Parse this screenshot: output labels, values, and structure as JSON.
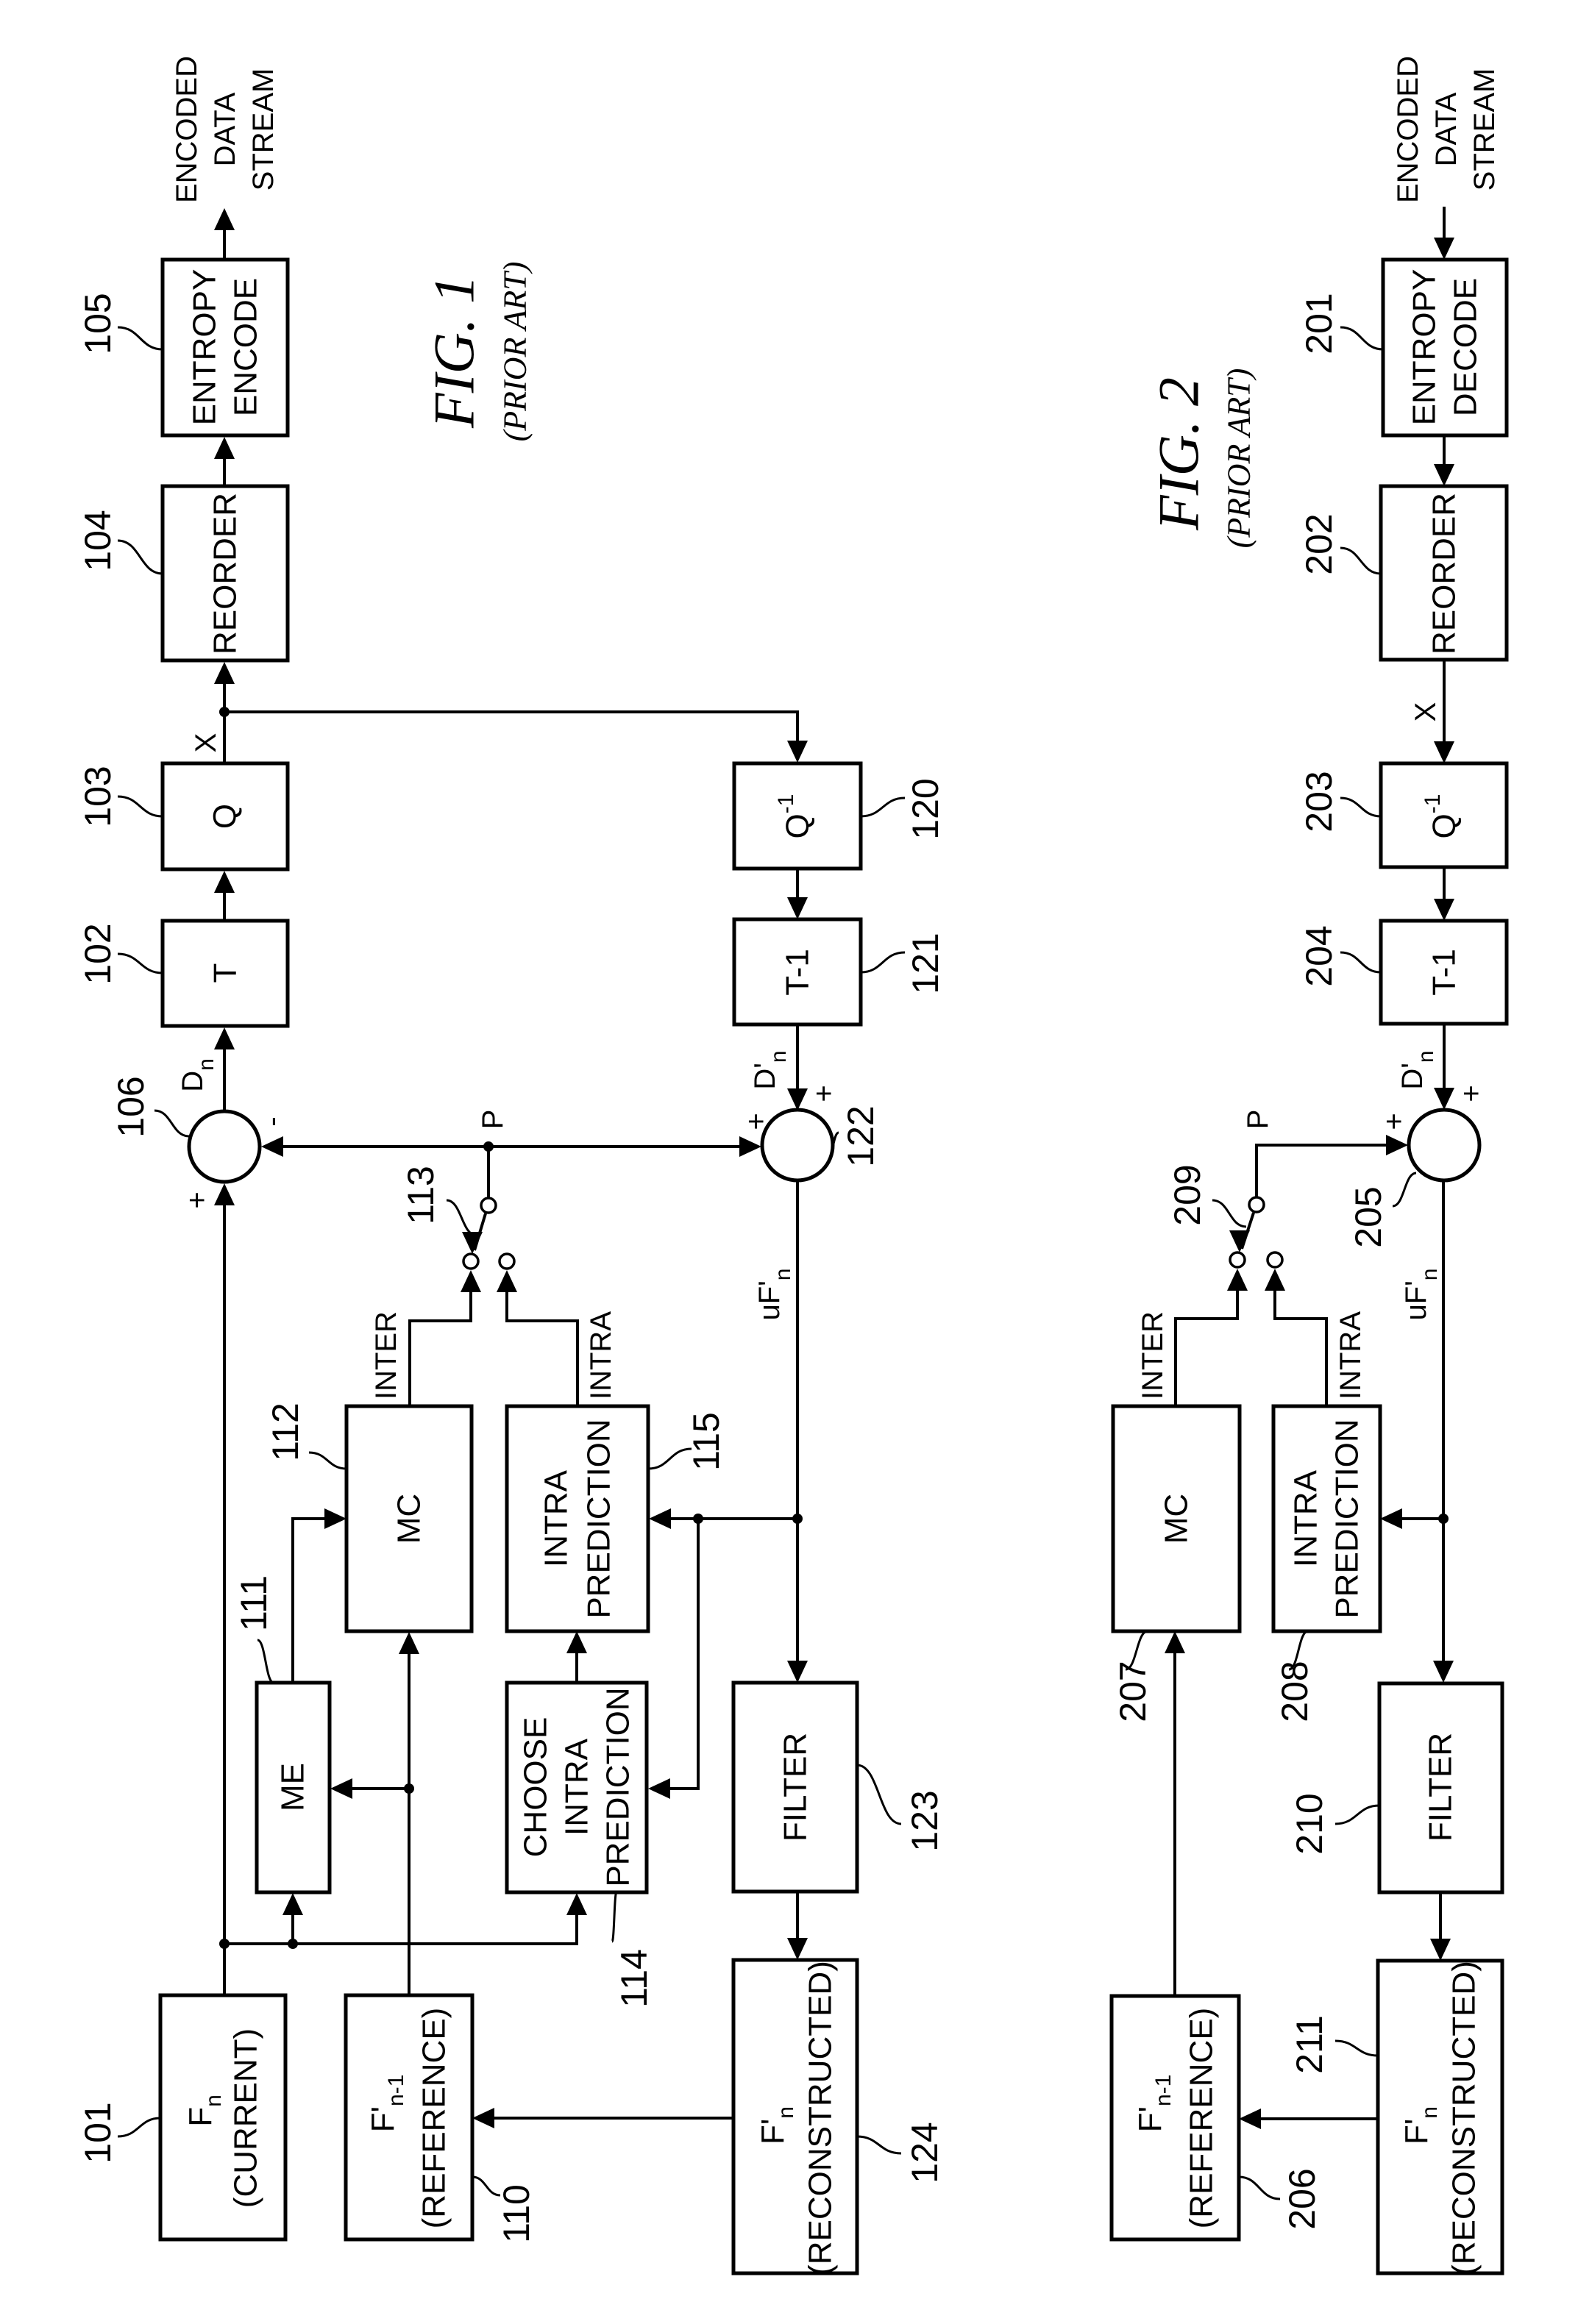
{
  "page": {
    "type": "patent drawing sheet",
    "background_color": "#ffffff",
    "ink_color": "#000000"
  },
  "figures": [
    {
      "id": "fig1",
      "caption": "FIG. 1",
      "subcaption": "(PRIOR ART)",
      "io_label": [
        "ENCODED",
        "DATA",
        "STREAM"
      ],
      "blocks": [
        {
          "id": "b105",
          "ref": "105",
          "lines": [
            "ENTROPY",
            "ENCODE"
          ]
        },
        {
          "id": "b104",
          "ref": "104",
          "lines": [
            "REORDER"
          ]
        },
        {
          "id": "b103",
          "ref": "103",
          "lines": [
            "Q"
          ]
        },
        {
          "id": "b102",
          "ref": "102",
          "lines": [
            "T"
          ]
        },
        {
          "id": "b120",
          "ref": "120",
          "main": "Q",
          "sup": "-1"
        },
        {
          "id": "b121",
          "ref": "121",
          "main": "T-1"
        },
        {
          "id": "b112",
          "ref": "112",
          "lines": [
            "MC"
          ]
        },
        {
          "id": "b115",
          "ref": "115",
          "lines": [
            "INTRA",
            "PREDICTION"
          ]
        },
        {
          "id": "b111",
          "ref": "111",
          "lines": [
            "ME"
          ]
        },
        {
          "id": "b114",
          "ref": "114",
          "lines": [
            "CHOOSE",
            "INTRA",
            "PREDICTION"
          ]
        },
        {
          "id": "b123",
          "ref": "123",
          "lines": [
            "FILTER"
          ]
        },
        {
          "id": "b101",
          "ref": "101",
          "main": "F",
          "sub": "n",
          "paren": "(CURRENT)"
        },
        {
          "id": "b110",
          "ref": "110",
          "main": "F'",
          "sub": "n-1",
          "paren": "(REFERENCE)"
        },
        {
          "id": "b124",
          "ref": "124",
          "main": "F'",
          "sub": "n",
          "paren": "(RECONSTRUCTED)"
        }
      ],
      "summers": [
        {
          "id": "s106",
          "ref": "106",
          "signs": [
            "+",
            "-"
          ]
        },
        {
          "id": "s122",
          "ref": "122",
          "signs": [
            "+",
            "+"
          ]
        }
      ],
      "switch": {
        "ref": "113",
        "inputs": [
          "INTER",
          "INTRA"
        ],
        "output": "P"
      },
      "signals": {
        "residual": {
          "main": "D",
          "sub": "n"
        },
        "coeffs": "X",
        "recon_residual": {
          "main": "D'",
          "sub": "n"
        },
        "unfiltered": {
          "main": "uF'",
          "sub": "n"
        },
        "prediction": "P",
        "inter": "INTER",
        "intra": "INTRA"
      }
    },
    {
      "id": "fig2",
      "caption": "FIG. 2",
      "subcaption": "(PRIOR ART)",
      "io_label": [
        "ENCODED",
        "DATA",
        "STREAM"
      ],
      "blocks": [
        {
          "id": "b201",
          "ref": "201",
          "lines": [
            "ENTROPY",
            "DECODE"
          ]
        },
        {
          "id": "b202",
          "ref": "202",
          "lines": [
            "REORDER"
          ]
        },
        {
          "id": "b203",
          "ref": "203",
          "main": "Q",
          "sup": "-1"
        },
        {
          "id": "b204",
          "ref": "204",
          "main": "T-1"
        },
        {
          "id": "b207",
          "ref": "207",
          "lines": [
            "MC"
          ]
        },
        {
          "id": "b208",
          "ref": "208",
          "lines": [
            "INTRA",
            "PREDICTION"
          ]
        },
        {
          "id": "b210",
          "ref": "210",
          "lines": [
            "FILTER"
          ]
        },
        {
          "id": "b206",
          "ref": "206",
          "main": "F'",
          "sub": "n-1",
          "paren": "(REFERENCE)"
        },
        {
          "id": "b211",
          "ref": "211",
          "main": "F'",
          "sub": "n",
          "paren": "(RECONSTRUCTED)"
        }
      ],
      "summers": [
        {
          "id": "s205",
          "ref": "205",
          "signs": [
            "+",
            "+"
          ]
        }
      ],
      "switch": {
        "ref": "209",
        "inputs": [
          "INTER",
          "INTRA"
        ],
        "output": "P"
      },
      "signals": {
        "coeffs": "X",
        "recon_residual": {
          "main": "D'",
          "sub": "n"
        },
        "unfiltered": {
          "main": "uF'",
          "sub": "n"
        },
        "prediction": "P",
        "inter": "INTER",
        "intra": "INTRA"
      }
    }
  ]
}
